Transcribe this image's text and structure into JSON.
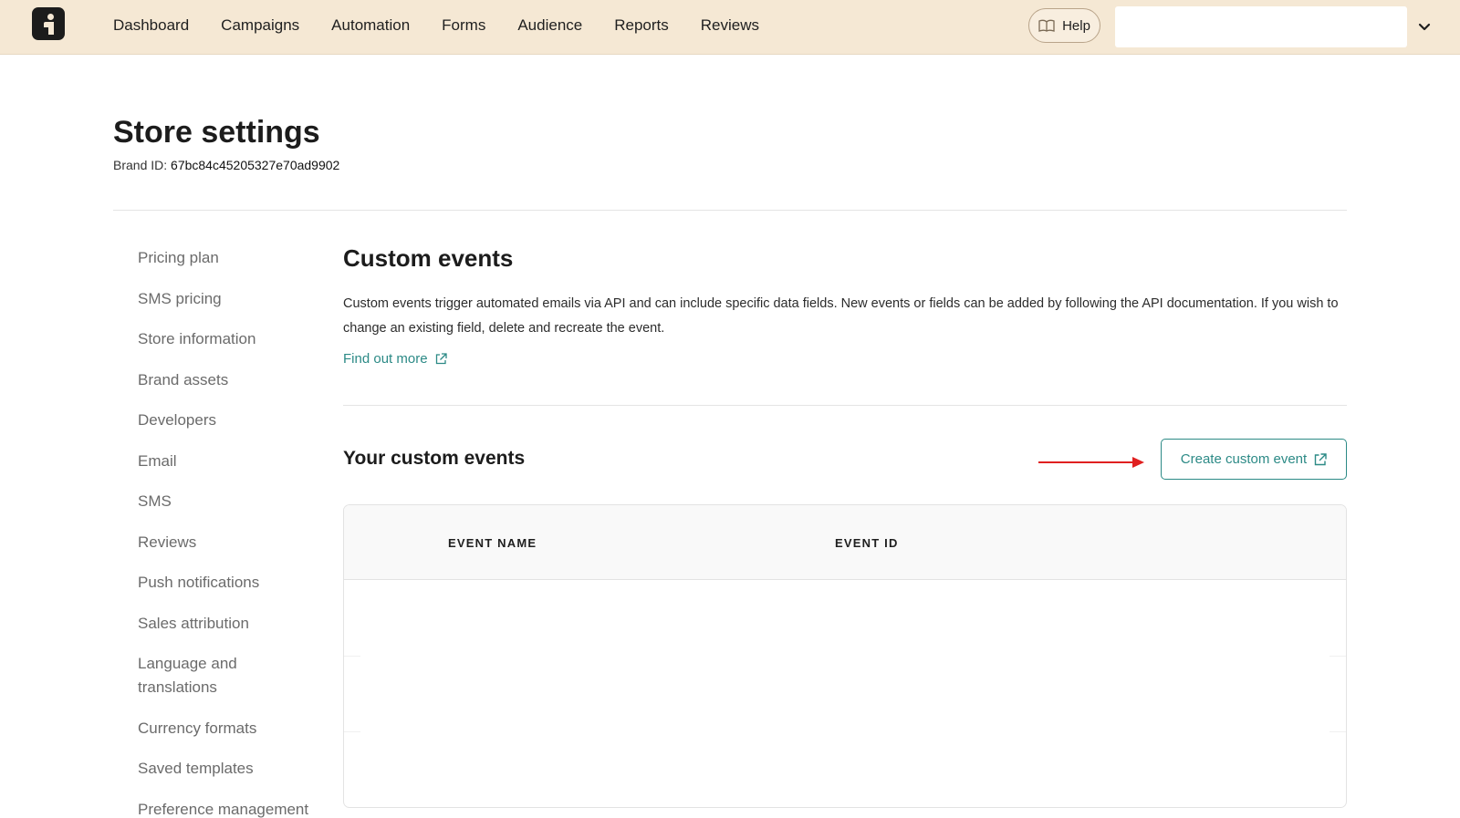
{
  "nav": {
    "items": [
      "Dashboard",
      "Campaigns",
      "Automation",
      "Forms",
      "Audience",
      "Reports",
      "Reviews"
    ],
    "help_label": "Help",
    "store_selector_value": ""
  },
  "page": {
    "title": "Store settings",
    "brand_id_label": "Brand ID:",
    "brand_id_value": "67bc84c45205327e70ad9902"
  },
  "sidebar": {
    "items": [
      "Pricing plan",
      "SMS pricing",
      "Store information",
      "Brand assets",
      "Developers",
      "Email",
      "SMS",
      "Reviews",
      "Push notifications",
      "Sales attribution",
      "Language and translations",
      "Currency formats",
      "Saved templates",
      "Preference management"
    ]
  },
  "main": {
    "title": "Custom events",
    "description": "Custom events trigger automated emails via API and can include specific data fields. New events or fields can be added by following the API documentation. If you wish to change an existing field, delete and recreate the event.",
    "find_out_more": "Find out more",
    "your_events_title": "Your custom events",
    "create_button": "Create custom event",
    "table": {
      "columns": [
        "EVENT NAME",
        "EVENT ID"
      ],
      "rows": []
    }
  },
  "colors": {
    "nav_bg": "#f5e8d4",
    "accent": "#2c8a86",
    "annotation_arrow": "#e02020"
  }
}
